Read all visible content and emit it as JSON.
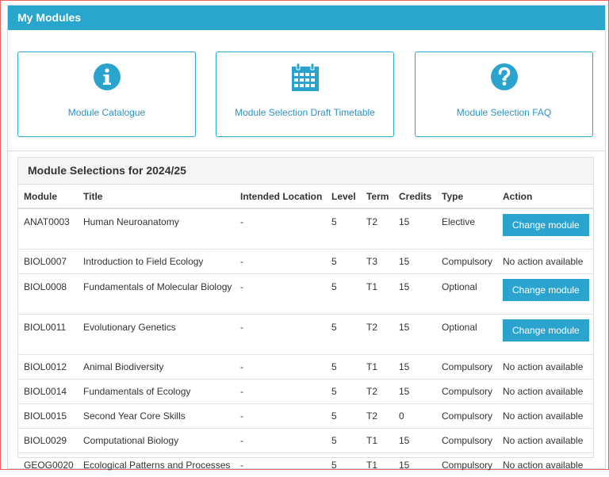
{
  "header": {
    "title": "My Modules"
  },
  "tiles": [
    {
      "label": "Module Catalogue",
      "icon": "info-icon"
    },
    {
      "label": "Module Selection Draft Timetable",
      "icon": "calendar-icon"
    },
    {
      "label": "Module Selection FAQ",
      "icon": "help-icon"
    }
  ],
  "selections": {
    "title": "Module Selections for 2024/25",
    "columns": [
      "Module",
      "Title",
      "Intended Location",
      "Level",
      "Term",
      "Credits",
      "Type",
      "Action"
    ],
    "rows": [
      {
        "module": "ANAT0003",
        "title": "Human Neuroanatomy",
        "location": "-",
        "level": "5",
        "term": "T2",
        "credits": "15",
        "type": "Elective",
        "action": "Change module",
        "action_is_button": true
      },
      {
        "module": "BIOL0007",
        "title": "Introduction to Field Ecology",
        "location": "-",
        "level": "5",
        "term": "T3",
        "credits": "15",
        "type": "Compulsory",
        "action": "No action available",
        "action_is_button": false
      },
      {
        "module": "BIOL0008",
        "title": "Fundamentals of Molecular Biology",
        "location": "-",
        "level": "5",
        "term": "T1",
        "credits": "15",
        "type": "Optional",
        "action": "Change module",
        "action_is_button": true
      },
      {
        "module": "BIOL0011",
        "title": "Evolutionary Genetics",
        "location": "-",
        "level": "5",
        "term": "T2",
        "credits": "15",
        "type": "Optional",
        "action": "Change module",
        "action_is_button": true
      },
      {
        "module": "BIOL0012",
        "title": "Animal Biodiversity",
        "location": "-",
        "level": "5",
        "term": "T1",
        "credits": "15",
        "type": "Compulsory",
        "action": "No action available",
        "action_is_button": false
      },
      {
        "module": "BIOL0014",
        "title": "Fundamentals of Ecology",
        "location": "-",
        "level": "5",
        "term": "T2",
        "credits": "15",
        "type": "Compulsory",
        "action": "No action available",
        "action_is_button": false
      },
      {
        "module": "BIOL0015",
        "title": "Second Year Core Skills",
        "location": "-",
        "level": "5",
        "term": "T2",
        "credits": "0",
        "type": "Compulsory",
        "action": "No action available",
        "action_is_button": false
      },
      {
        "module": "BIOL0029",
        "title": "Computational Biology",
        "location": "-",
        "level": "5",
        "term": "T1",
        "credits": "15",
        "type": "Compulsory",
        "action": "No action available",
        "action_is_button": false
      },
      {
        "module": "GEOG0020",
        "title": "Ecological Patterns and Processes",
        "location": "-",
        "level": "5",
        "term": "T1",
        "credits": "15",
        "type": "Compulsory",
        "action": "No action available",
        "action_is_button": false
      }
    ]
  },
  "colors": {
    "accent": "#29a6cd",
    "link": "#2b94c6",
    "button": "#2aa4ce",
    "frame": "#e8615f"
  }
}
